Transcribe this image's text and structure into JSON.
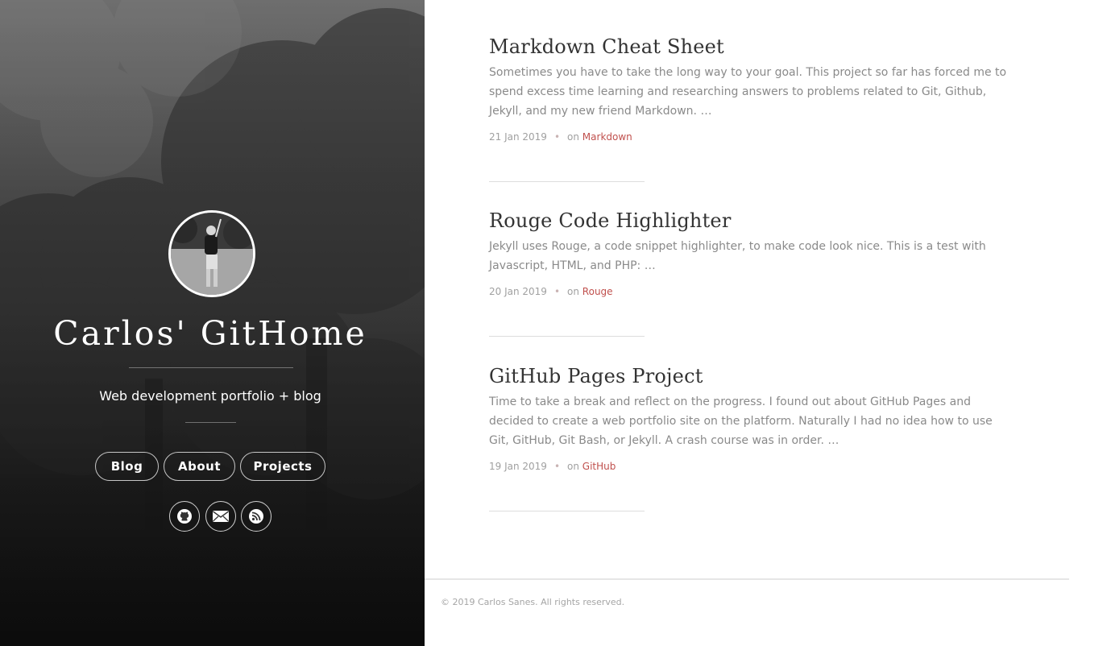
{
  "sidebar": {
    "title": "Carlos' GitHome",
    "tagline": "Web development portfolio + blog",
    "nav": [
      {
        "label": "Blog"
      },
      {
        "label": "About"
      },
      {
        "label": "Projects"
      }
    ],
    "social": [
      {
        "icon": "github-icon"
      },
      {
        "icon": "mail-icon"
      },
      {
        "icon": "rss-icon"
      }
    ]
  },
  "posts": [
    {
      "title": "Markdown Cheat Sheet",
      "excerpt": "Sometimes you have to take the long way to your goal. This project so far has forced me to spend excess time learning and researching answers to problems related to Git, Github, Jekyll, and my new friend Markdown. …",
      "date": "21 Jan 2019",
      "dot": "•",
      "on": "on",
      "category": "Markdown"
    },
    {
      "title": "Rouge Code Highlighter",
      "excerpt": "Jekyll uses Rouge, a code snippet highlighter, to make code look nice. This is a test with Javascript, HTML, and PHP: …",
      "date": "20 Jan 2019",
      "dot": "•",
      "on": "on",
      "category": "Rouge"
    },
    {
      "title": "GitHub Pages Project",
      "excerpt": "Time to take a break and reflect on the progress. I found out about GitHub Pages and decided to create a web portfolio site on the platform. Naturally I had no idea how to use Git, GitHub, Git Bash, or Jekyll. A crash course was in order. …",
      "date": "19 Jan 2019",
      "dot": "•",
      "on": "on",
      "category": "GitHub"
    }
  ],
  "footer": {
    "copyright": "© 2019 Carlos Sanes. All rights reserved."
  },
  "colors": {
    "accent": "#c0504d",
    "title_text": "#333333",
    "excerpt_text": "#8a8a8a"
  }
}
